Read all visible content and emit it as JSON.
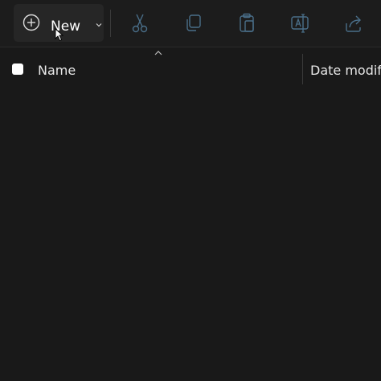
{
  "toolbar": {
    "new_label": "New",
    "tools": [
      {
        "icon": "cut-icon",
        "enabled": false
      },
      {
        "icon": "copy-icon",
        "enabled": false
      },
      {
        "icon": "paste-icon",
        "enabled": false
      },
      {
        "icon": "rename-icon",
        "enabled": false
      },
      {
        "icon": "share-icon",
        "enabled": false
      }
    ]
  },
  "header": {
    "name_label": "Name",
    "date_label": "Date modified",
    "sort": "ascending"
  },
  "colors": {
    "background": "#191919",
    "toolbar": "#1c1c1c",
    "new_button": "#262626",
    "disabled_icon": "#4a6f8a",
    "text": "#e8e8e8"
  }
}
